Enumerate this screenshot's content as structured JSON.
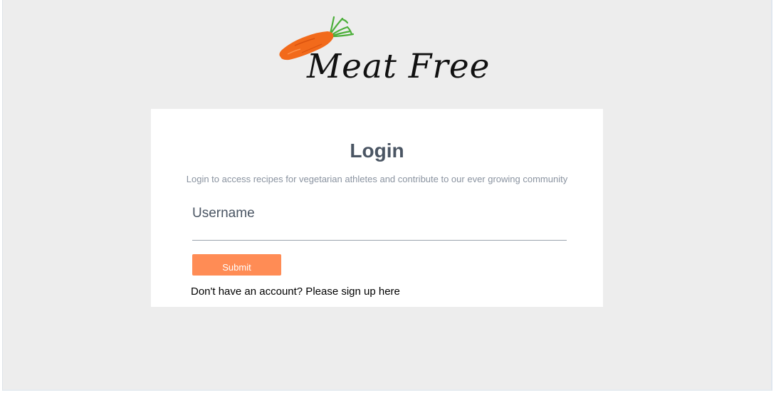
{
  "logo": {
    "text": "Meat Free",
    "icon": "carrot-icon",
    "colors": {
      "carrot": "#f26a1b",
      "leaves": "#4caf3a"
    }
  },
  "login": {
    "title": "Login",
    "subtitle": "Login to access recipes for vegetarian athletes and contribute to our ever growing community",
    "username_label": "Username",
    "username_value": "",
    "submit_label": "Submit",
    "signup_text": "Don't have an account? Please sign up here"
  },
  "colors": {
    "background": "#ededed",
    "card": "#ffffff",
    "accent": "#ff8c55",
    "heading": "#4a5563",
    "muted": "#8a93a0"
  }
}
